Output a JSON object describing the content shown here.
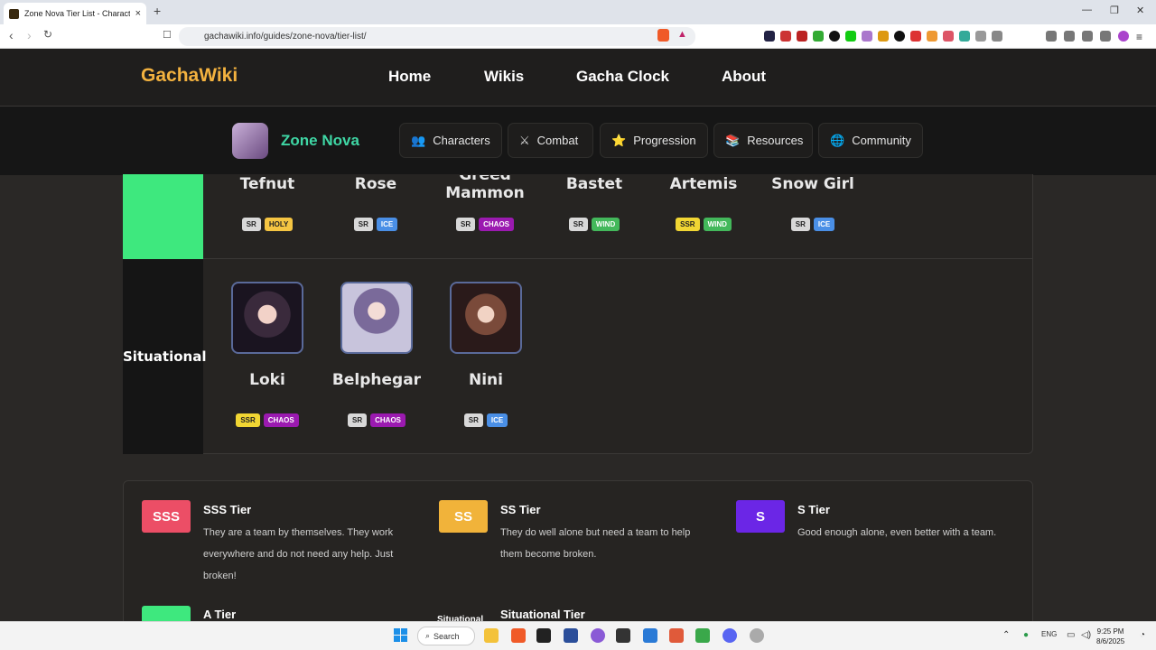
{
  "browser": {
    "tab_title": "Zone Nova Tier List - Character R",
    "tab_close": "×",
    "new_tab": "+",
    "url": "gachawiki.info/guides/zone-nova/tier-list/",
    "win_min": "—",
    "win_max": "❐",
    "win_close": "✕"
  },
  "site": {
    "logo": "GachaWiki",
    "nav": [
      "Home",
      "Wikis",
      "Gacha Clock",
      "About"
    ],
    "game_name": "Zone Nova",
    "subnav": [
      {
        "label": "Characters",
        "icon": "👥"
      },
      {
        "label": "Combat",
        "icon": "⚔"
      },
      {
        "label": "Progression",
        "icon": "⭐"
      },
      {
        "label": "Resources",
        "icon": "📚"
      },
      {
        "label": "Community",
        "icon": "🌐"
      }
    ]
  },
  "tiers": {
    "a_row": [
      {
        "name": "Tefnut",
        "rarity": "SR",
        "element": "HOLY"
      },
      {
        "name": "Rose",
        "rarity": "SR",
        "element": "ICE"
      },
      {
        "name": "Greed\nMammon",
        "rarity": "SR",
        "element": "CHAOS"
      },
      {
        "name": "Bastet",
        "rarity": "SR",
        "element": "WIND"
      },
      {
        "name": "Artemis",
        "rarity": "SSR",
        "element": "WIND"
      },
      {
        "name": "Snow Girl",
        "rarity": "SR",
        "element": "ICE"
      }
    ],
    "situational_label": "Situational",
    "situational_row": [
      {
        "name": "Loki",
        "rarity": "SSR",
        "element": "CHAOS"
      },
      {
        "name": "Belphegar",
        "rarity": "SR",
        "element": "CHAOS"
      },
      {
        "name": "Nini",
        "rarity": "SR",
        "element": "ICE"
      }
    ]
  },
  "legend": [
    {
      "badge": "SSS",
      "title": "SSS Tier",
      "desc": "They are a team by themselves. They work everywhere and do not need any help. Just broken!",
      "color": "#ec4e66"
    },
    {
      "badge": "SS",
      "title": "SS Tier",
      "desc": "They do well alone but need a team to help them become broken.",
      "color": "#f1b33a"
    },
    {
      "badge": "S",
      "title": "S Tier",
      "desc": "Good enough alone, even better with a team.",
      "color": "#6b26e6"
    },
    {
      "badge": "A",
      "title": "A Tier",
      "desc": "",
      "color": "#3ee87e"
    },
    {
      "badge": "Situational",
      "title": "Situational Tier",
      "desc": "",
      "color": "#262422"
    }
  ],
  "taskbar": {
    "search": "Search",
    "lang": "ENG",
    "time": "9:25 PM",
    "date": "8/6/2025"
  }
}
